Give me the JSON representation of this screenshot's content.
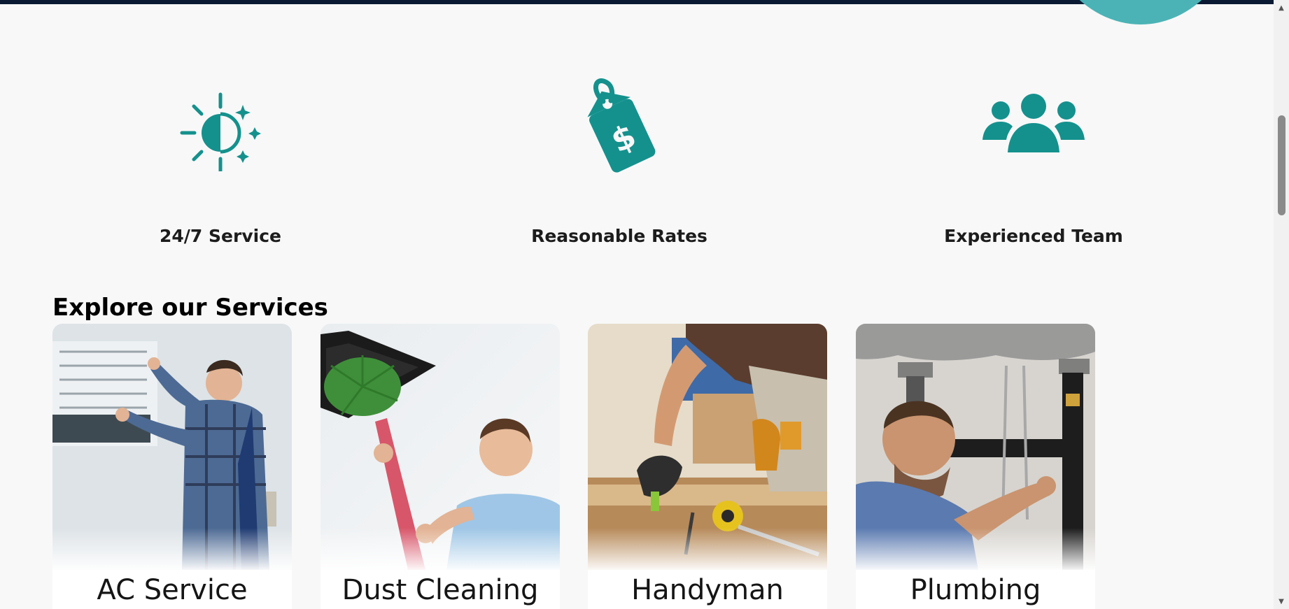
{
  "colors": {
    "accent": "#14918d",
    "navbar": "#0b1a33",
    "blob": "#4bb3b5"
  },
  "features": [
    {
      "icon": "sun-moon-icon",
      "label": "24/7 Service"
    },
    {
      "icon": "price-tag-dollar-icon",
      "label": "Reasonable Rates"
    },
    {
      "icon": "team-group-icon",
      "label": "Experienced Team"
    }
  ],
  "services": {
    "title": "Explore our Services",
    "cards": [
      {
        "name": "AC Service",
        "image": "technician-cleaning-air-conditioner"
      },
      {
        "name": "Dust Cleaning",
        "image": "man-dusting-ceiling-vent"
      },
      {
        "name": "Handyman",
        "image": "worker-with-tools-and-tape-measure"
      },
      {
        "name": "Plumbing",
        "image": "plumber-fixing-sink-pipes"
      }
    ]
  },
  "scrollbar": {
    "up_arrow": "▲",
    "down_arrow": "▼"
  }
}
